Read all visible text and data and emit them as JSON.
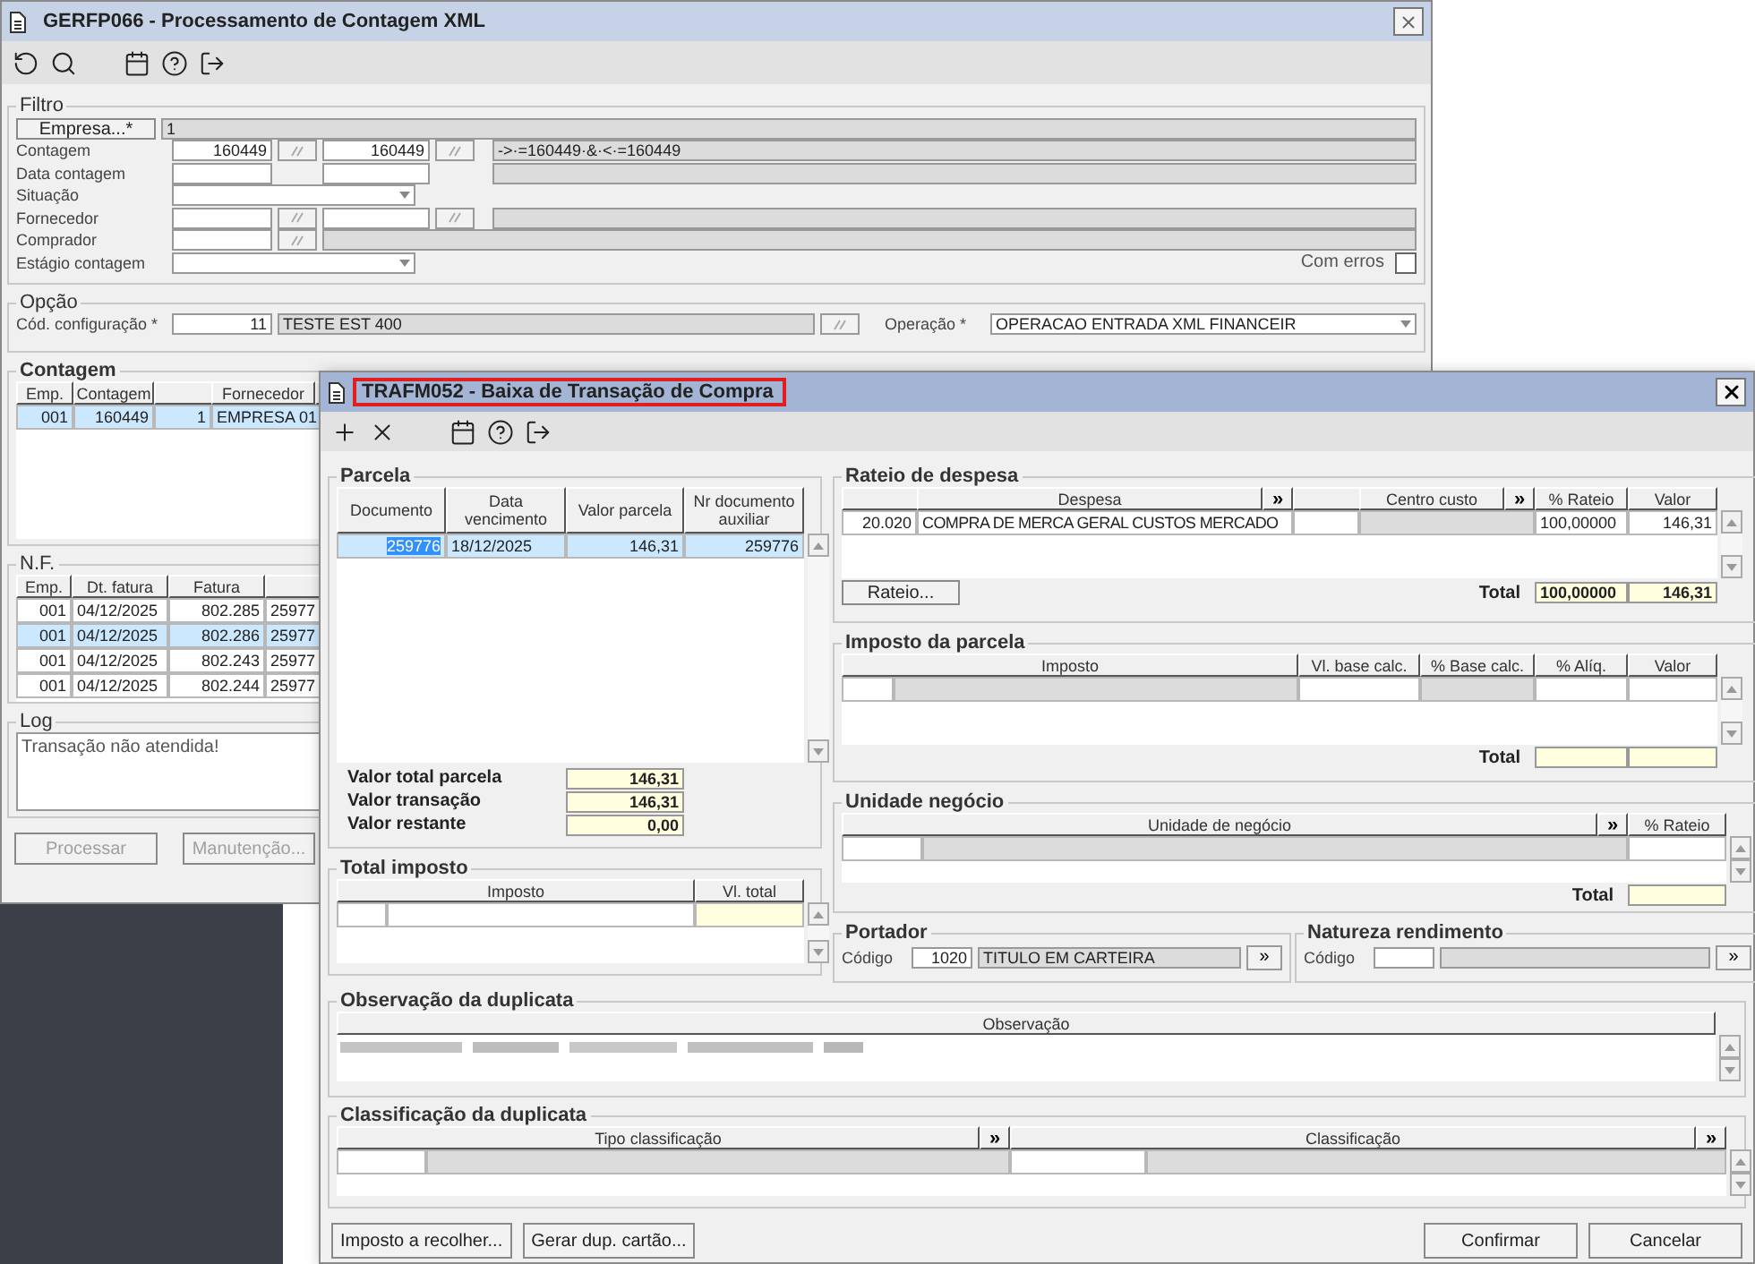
{
  "main_window": {
    "title": "GERFP066 - Processamento de Contagem XML",
    "filter": {
      "legend": "Filtro",
      "empresa_button": "Empresa...*",
      "empresa_value": "1",
      "rows": [
        {
          "label": "Contagem",
          "kind": "range",
          "from": "160449",
          "to": "160449",
          "description": "->·=160449·&·<·=160449"
        },
        {
          "label": "Data contagem",
          "kind": "dates"
        },
        {
          "label": "Situação",
          "kind": "combo"
        },
        {
          "label": "Fornecedor",
          "kind": "range"
        },
        {
          "label": "Comprador",
          "kind": "single"
        },
        {
          "label": "Estágio contagem",
          "kind": "combo"
        }
      ],
      "com_erros": {
        "label": "Com erros",
        "checked": false
      }
    },
    "option": {
      "legend": "Opção",
      "config_label": "Cód. configuração *",
      "config_code": "11",
      "config_name": "TESTE EST 400",
      "operation_label": "Operação *",
      "operation": "OPERACAO ENTRADA XML FINANCEIR"
    },
    "contagem": {
      "legend": "Contagem",
      "columns": [
        {
          "label": "Emp."
        },
        {
          "label": "Contagem"
        },
        {
          "kind": "blank"
        },
        {
          "label": "Fornecedor"
        }
      ],
      "rows": [
        {
          "cells": [
            "001",
            "160449",
            "1",
            "EMPRESA 01"
          ],
          "selected": true
        }
      ]
    },
    "nf": {
      "legend": "N.F.",
      "columns": [
        {
          "label": "Emp."
        },
        {
          "label": "Dt. fatura"
        },
        {
          "label": "Fatura"
        }
      ],
      "rows": [
        {
          "cells": [
            "001",
            "04/12/2025",
            "802.285",
            "25977"
          ],
          "selected": false
        },
        {
          "cells": [
            "001",
            "04/12/2025",
            "802.286",
            "25977"
          ],
          "selected": true
        },
        {
          "cells": [
            "001",
            "04/12/2025",
            "802.243",
            "25977"
          ],
          "selected": false
        },
        {
          "cells": [
            "001",
            "04/12/2025",
            "802.244",
            "25977"
          ],
          "selected": false
        }
      ]
    },
    "log": {
      "legend": "Log",
      "text": "Transação não atendida!"
    },
    "buttons": [
      {
        "label": "Processar",
        "disabled": true
      },
      {
        "label": "Manutenção...",
        "disabled": true
      }
    ]
  },
  "dialog": {
    "title": "TRAFM052 - Baixa de Transação de Compra",
    "title_highlighted": true,
    "parcela": {
      "legend": "Parcela",
      "columns": [
        {
          "label": "Documento"
        },
        {
          "label": "Data vencimento"
        },
        {
          "label": "Valor parcela"
        },
        {
          "label": "Nr documento auxiliar"
        }
      ],
      "rows": [
        {
          "cells": [
            "259776",
            "18/12/2025",
            "146,31",
            "259776"
          ],
          "selected": true
        }
      ],
      "totals": [
        {
          "label": "Valor total parcela",
          "value": "146,31"
        },
        {
          "label": "Valor transação",
          "value": "146,31"
        },
        {
          "label": "Valor restante",
          "value": "0,00"
        }
      ]
    },
    "total_imposto": {
      "legend": "Total imposto",
      "columns": [
        {
          "label": "Imposto"
        },
        {
          "label": "Vl. total"
        }
      ]
    },
    "rateio": {
      "legend": "Rateio de despesa",
      "columns": [
        {
          "kind": "blank"
        },
        {
          "label": "Despesa",
          "button": "»"
        },
        {
          "kind": "blank"
        },
        {
          "label": "Centro custo",
          "button": "»"
        },
        {
          "label": "% Rateio"
        },
        {
          "label": "Valor"
        }
      ],
      "rows": [
        {
          "cells": [
            "20.020",
            "COMPRA DE MERCA GERAL CUSTOS MERCADO",
            "",
            "",
            "100,00000",
            "146,31"
          ],
          "selected": false
        }
      ],
      "button": "Rateio...",
      "total_label": "Total",
      "totals": [
        "100,00000",
        "146,31"
      ]
    },
    "imposto_parcela": {
      "legend": "Imposto da parcela",
      "columns": [
        {
          "label": "Imposto"
        },
        {
          "label": "Vl. base calc."
        },
        {
          "label": "% Base calc."
        },
        {
          "label": "% Alíq."
        },
        {
          "label": "Valor"
        }
      ],
      "total_label": "Total"
    },
    "unidade": {
      "legend": "Unidade negócio",
      "columns": [
        {
          "label": "Unidade de negócio",
          "button": "»"
        },
        {
          "label": "% Rateio"
        }
      ],
      "total_label": "Total"
    },
    "portador": {
      "legend": "Portador",
      "code_label": "Código",
      "code": "1020",
      "name": "TITULO EM CARTEIRA",
      "button": "»"
    },
    "natureza": {
      "legend": "Natureza rendimento",
      "code_label": "Código",
      "button": "»"
    },
    "observacao": {
      "legend": "Observação da duplicata",
      "columns": [
        {
          "label": "Observação"
        }
      ]
    },
    "classificacao": {
      "legend": "Classificação da duplicata",
      "columns": [
        {
          "label": "Tipo classificação",
          "button": "»"
        },
        {
          "label": "Classificação",
          "button": "»"
        }
      ]
    },
    "left_buttons": [
      "Imposto a recolher...",
      "Gerar dup. cartão..."
    ],
    "right_buttons": [
      "Confirmar",
      "Cancelar"
    ]
  }
}
